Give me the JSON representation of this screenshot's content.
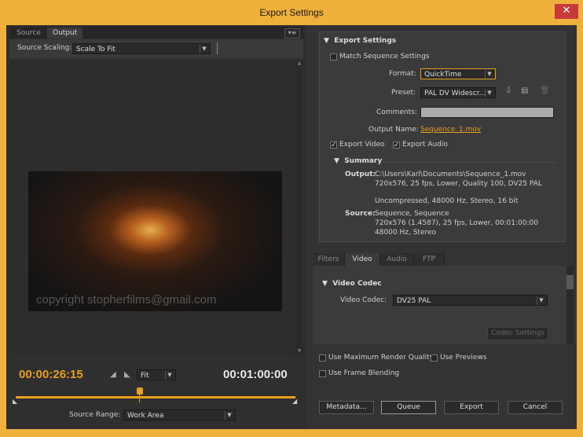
{
  "window": {
    "title": "Export Settings",
    "close_glyph": "✕"
  },
  "left_tabs": [
    {
      "label": "Source"
    },
    {
      "label": "Output"
    }
  ],
  "panel_menu_glyph": "▾≡",
  "source_scaling": {
    "label": "Source Scaling:",
    "value": "Scale To Fit"
  },
  "preview": {
    "watermark": "copyright stopherfilms@gmail.com"
  },
  "transport": {
    "current_time": "00:00:26:15",
    "duration": "00:01:00:00",
    "zoom": "Fit",
    "source_range_label": "Source Range:",
    "source_range_value": "Work Area"
  },
  "export": {
    "header": "Export Settings",
    "match_sequence": "Match Sequence Settings",
    "format_label": "Format:",
    "format_value": "QuickTime",
    "preset_label": "Preset:",
    "preset_value": "PAL DV Widescr...",
    "comments_label": "Comments:",
    "output_name_label": "Output Name:",
    "output_name": "Sequence_1.mov",
    "export_video": "Export Video",
    "export_audio": "Export Audio"
  },
  "summary": {
    "header": "Summary",
    "output_label": "Output:",
    "output_lines": [
      "C:\\Users\\Karl\\Documents\\Sequence_1.mov",
      "720x576, 25 fps, Lower, Quality 100, DV25 PAL",
      "Uncompressed, 48000 Hz, Stereo, 16 bit"
    ],
    "source_label": "Source:",
    "source_lines": [
      "Sequence, Sequence",
      "720x576 (1.4587), 25 fps, Lower, 00:01:00:00",
      "48000 Hz, Stereo"
    ]
  },
  "sub_tabs": [
    {
      "label": "Filters"
    },
    {
      "label": "Video"
    },
    {
      "label": "Audio"
    },
    {
      "label": "FTP"
    }
  ],
  "video_codec": {
    "header": "Video Codec",
    "label": "Video Codec:",
    "value": "DV25 PAL",
    "settings_button": "Codec Settings"
  },
  "options": {
    "max_render_quality": "Use Maximum Render Quality",
    "use_previews": "Use Previews",
    "frame_blending": "Use Frame Blending"
  },
  "buttons": {
    "metadata": "Metadata...",
    "queue": "Queue",
    "export": "Export",
    "cancel": "Cancel"
  },
  "colors": {
    "accent": "#e5a020",
    "frame": "#f0b03c",
    "close": "#c63a3a"
  }
}
